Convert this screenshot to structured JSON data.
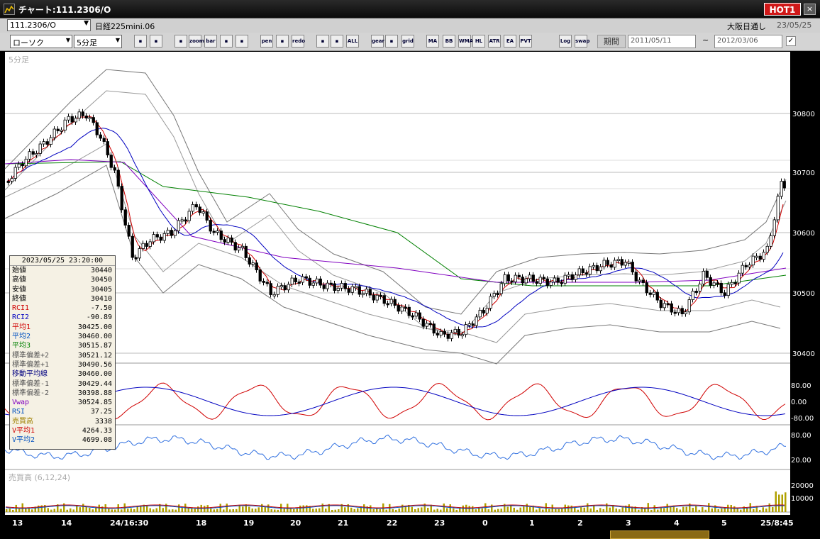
{
  "window": {
    "title": "チャート:111.2306/O",
    "hot_label": "HOT1",
    "close_label": "×"
  },
  "header": {
    "symbol": "111.2306/O",
    "symbol_name": "日経225mini.06",
    "market": "大阪日通し",
    "date": "23/05/25"
  },
  "toolbar": {
    "chart_type": "ローソク",
    "timeframe": "5分足",
    "buttons": [
      "search",
      "crosshair",
      "download",
      "zoom",
      "bar",
      "arrow",
      "alert",
      "pen",
      "cursor",
      "redo",
      "cand1",
      "cand2",
      "ALL",
      "gear",
      "wrench",
      "grid",
      "MA",
      "BB",
      "WMA",
      "HL",
      "ATR",
      "EA",
      "PVT",
      "Log",
      "swap"
    ],
    "period_label": "期間",
    "date_from": "2011/05/11",
    "date_to": "2012/03/06",
    "tilde": "~"
  },
  "chart": {
    "timeframe_label": "5分足",
    "price_ticks": [
      "30800",
      "30700",
      "30600",
      "30500",
      "30400"
    ],
    "osc_ticks": [
      "80.00",
      "0.00",
      "-80.00"
    ],
    "rsi_ticks": [
      "80.00",
      "20.00"
    ],
    "volume_label": "売買高 (6,12,24)",
    "volume_ticks": [
      "20000",
      "10000"
    ],
    "x_labels": [
      "13",
      "14",
      "24/16:30",
      "18",
      "19",
      "20",
      "21",
      "22",
      "23",
      "0",
      "1",
      "2",
      "3",
      "4",
      "5",
      "25/8:45"
    ]
  },
  "info_panel": {
    "time": "2023/05/25  23:20:00",
    "rows": [
      {
        "k": "始値",
        "v": "30440",
        "c": "#000"
      },
      {
        "k": "高値",
        "v": "30450",
        "c": "#000"
      },
      {
        "k": "安値",
        "v": "30405",
        "c": "#000"
      },
      {
        "k": "終値",
        "v": "30410",
        "c": "#000"
      },
      {
        "k": "RCI1",
        "v": "-7.50",
        "c": "#d00000"
      },
      {
        "k": "RCI2",
        "v": "-90.89",
        "c": "#0000c0"
      },
      {
        "k": "平均1",
        "v": "30425.00",
        "c": "#d00000"
      },
      {
        "k": "平均2",
        "v": "30460.00",
        "c": "#0050c0"
      },
      {
        "k": "平均3",
        "v": "30515.87",
        "c": "#008000"
      },
      {
        "k": "標準偏差+2",
        "v": "30521.12",
        "c": "#555"
      },
      {
        "k": "標準偏差+1",
        "v": "30490.56",
        "c": "#555"
      },
      {
        "k": "移動平均線",
        "v": "30460.00",
        "c": "#000080"
      },
      {
        "k": "標準偏差-1",
        "v": "30429.44",
        "c": "#555"
      },
      {
        "k": "標準偏差-2",
        "v": "30398.88",
        "c": "#555"
      },
      {
        "k": "Vwap",
        "v": "30524.85",
        "c": "#8000c0"
      },
      {
        "k": "RSI",
        "v": "37.25",
        "c": "#0050c0"
      },
      {
        "k": "売買高",
        "v": "3338",
        "c": "#a08000"
      },
      {
        "k": "V平均1",
        "v": "4264.33",
        "c": "#d00000"
      },
      {
        "k": "V平均2",
        "v": "4699.08",
        "c": "#0050c0"
      }
    ]
  },
  "colors": {
    "up": "#ffffff",
    "down": "#000000",
    "ma1": "#d00000",
    "ma2": "#0000c0",
    "ma3": "#008000",
    "vwap": "#8000c0",
    "bb": "#888888",
    "rsi": "#3070e0",
    "volume": "#b0a000"
  }
}
